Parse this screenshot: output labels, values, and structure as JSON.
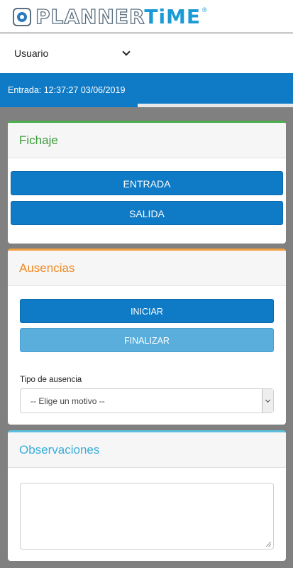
{
  "header": {
    "logo_left": "PLANNER",
    "logo_right": "TiME",
    "logo_reg": "®"
  },
  "user_select": {
    "value": "Usuario"
  },
  "status": {
    "text": "Entrada: 12:37:27 03/06/2019"
  },
  "fichaje": {
    "title": "Fichaje",
    "entrada_label": "ENTRADA",
    "salida_label": "SALIDA"
  },
  "ausencias": {
    "title": "Ausencias",
    "iniciar_label": "INICIAR",
    "finalizar_label": "FINALIZAR",
    "tipo_label": "Tipo de ausencia",
    "tipo_value": "-- Elige un motivo --"
  },
  "observaciones": {
    "title": "Observaciones",
    "text": ""
  },
  "colors": {
    "primary": "#0f7ac5",
    "fichaje": "#4cae4c",
    "ausencias": "#f08a24",
    "observaciones": "#5bc0de"
  }
}
